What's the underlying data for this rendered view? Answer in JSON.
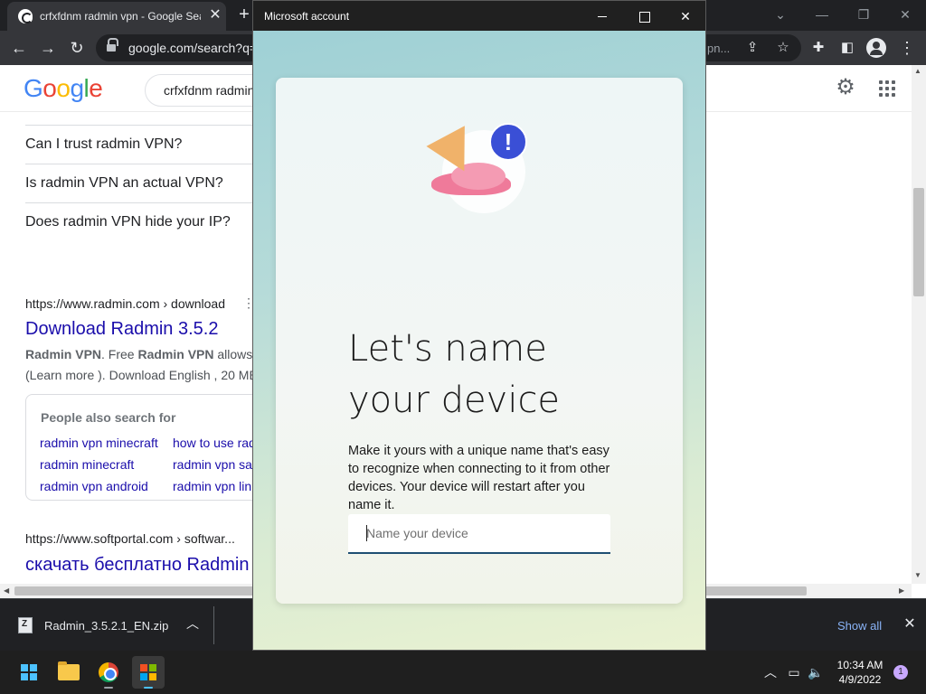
{
  "browser": {
    "tab_title": "crfxfdnm radmin vpn - Google Search",
    "url": "google.com/search?q=crfxfdnm+radmin+vpn",
    "url_tail": "pn..."
  },
  "google": {
    "logo": "Google",
    "query": "crfxfdnm radmin vpn",
    "people_also_ask": [
      "Can I trust radmin VPN?",
      "Is radmin VPN an actual VPN?",
      "Does radmin VPN hide your IP?"
    ],
    "result1": {
      "cite": "https://www.radmin.com › download",
      "title": "Download Radmin 3.5.2",
      "snippet_bold1": "Radmin VPN",
      "snippet_mid": ". Free ",
      "snippet_bold2": "Radmin VPN",
      "snippet_tail": " allows y",
      "snippet_line2": "(Learn more ). Download English , 20 MB"
    },
    "people_also_search": {
      "title": "People also search for",
      "links": [
        "radmin vpn minecraft",
        "how to use rad",
        "radmin minecraft",
        "radmin vpn sa",
        "radmin vpn android",
        "radmin vpn lin"
      ]
    },
    "result2": {
      "cite": "https://www.softportal.com › softwar...",
      "title": "скачать бесплатно Radmin"
    }
  },
  "download_bar": {
    "file_name": "Radmin_3.5.2.1_EN.zip",
    "show_all": "Show all"
  },
  "taskbar": {
    "time": "10:34 AM",
    "date": "4/9/2022",
    "notifications": "1"
  },
  "dialog": {
    "window_title": "Microsoft account",
    "heading": "Let's name your device",
    "description": "Make it yours with a unique name that's easy to recognize when connecting to it from other devices. Your device will restart after you name it.",
    "input_placeholder": "Name your device"
  },
  "colors": {
    "link_blue": "#1a0dab",
    "dialog_accent": "#1f4f73",
    "alert_badge": "#3a4fd6"
  }
}
